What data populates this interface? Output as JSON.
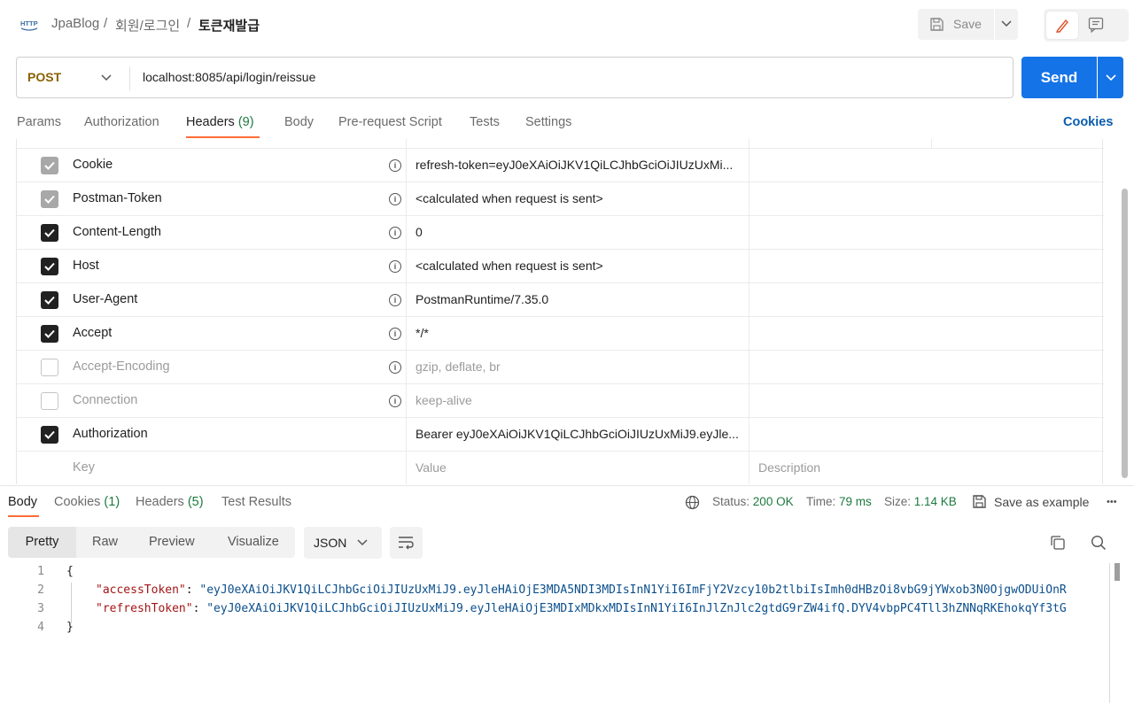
{
  "breadcrumb": {
    "collection": "JpaBlog",
    "folder": "회원/로그인",
    "request": "토큰재발급",
    "separator": "/"
  },
  "toolbar": {
    "save_label": "Save"
  },
  "request": {
    "method": "POST",
    "url": "localhost:8085/api/login/reissue",
    "send_label": "Send"
  },
  "request_tabs": [
    {
      "label": "Params"
    },
    {
      "label": "Authorization"
    },
    {
      "label": "Headers",
      "count": "(9)"
    },
    {
      "label": "Body"
    },
    {
      "label": "Pre-request Script"
    },
    {
      "label": "Tests"
    },
    {
      "label": "Settings"
    }
  ],
  "cookies_link": "Cookies",
  "headers": [
    {
      "key": "Cookie",
      "value": "refresh-token=eyJ0eXAiOiJKV1QiLCJhbGciOiJIUzUxMi...",
      "checked": "locked"
    },
    {
      "key": "Postman-Token",
      "value": "<calculated when request is sent>",
      "checked": "locked"
    },
    {
      "key": "Content-Length",
      "value": "0",
      "checked": "on"
    },
    {
      "key": "Host",
      "value": "<calculated when request is sent>",
      "checked": "on"
    },
    {
      "key": "User-Agent",
      "value": "PostmanRuntime/7.35.0",
      "checked": "on"
    },
    {
      "key": "Accept",
      "value": "*/*",
      "checked": "on"
    },
    {
      "key": "Accept-Encoding",
      "value": "gzip, deflate, br",
      "checked": "off"
    },
    {
      "key": "Connection",
      "value": "keep-alive",
      "checked": "off"
    },
    {
      "key": "Authorization",
      "value": "Bearer eyJ0eXAiOiJKV1QiLCJhbGciOiJIUzUxMiJ9.eyJle...",
      "checked": "on"
    }
  ],
  "new_header": {
    "key_placeholder": "Key",
    "value_placeholder": "Value",
    "description_placeholder": "Description"
  },
  "response_tabs": [
    {
      "label": "Body"
    },
    {
      "label": "Cookies",
      "count": "(1)"
    },
    {
      "label": "Headers",
      "count": "(5)"
    },
    {
      "label": "Test Results"
    }
  ],
  "response_meta": {
    "status_label": "Status:",
    "status_value": "200 OK",
    "time_label": "Time:",
    "time_value": "79 ms",
    "size_label": "Size:",
    "size_value": "1.14 KB",
    "save_example": "Save as example",
    "more": "•••"
  },
  "view_tabs": [
    {
      "label": "Pretty"
    },
    {
      "label": "Raw"
    },
    {
      "label": "Preview"
    },
    {
      "label": "Visualize"
    }
  ],
  "format": "JSON",
  "code_lines": [
    {
      "n": "1",
      "text": "{"
    },
    {
      "n": "2",
      "key": "\"accessToken\"",
      "value": "\"eyJ0eXAiOiJKV1QiLCJhbGciOiJIUzUxMiJ9.eyJleHAiOjE3MDA5NDI3MDIsInN1YiI6ImFjY2Vzcy10b2tlbiIsImh0dHBzOi8vbG9jYWxob3N0OjgwODUiOnR"
    },
    {
      "n": "3",
      "key": "\"refreshToken\"",
      "value": "\"eyJ0eXAiOiJKV1QiLCJhbGciOiJIUzUxMiJ9.eyJleHAiOjE3MDIxMDkxMDIsInN1YiI6InJlZnJlc2gtdG9rZW4ifQ.DYV4vbpPC4Tll3hZNNqRKEhokqYf3tG"
    },
    {
      "n": "4",
      "text": "}"
    }
  ],
  "colors": {
    "send": "#1473e6",
    "accent": "#ff6c37",
    "method": "#8a6100",
    "status_ok": "#1c7a3e"
  }
}
